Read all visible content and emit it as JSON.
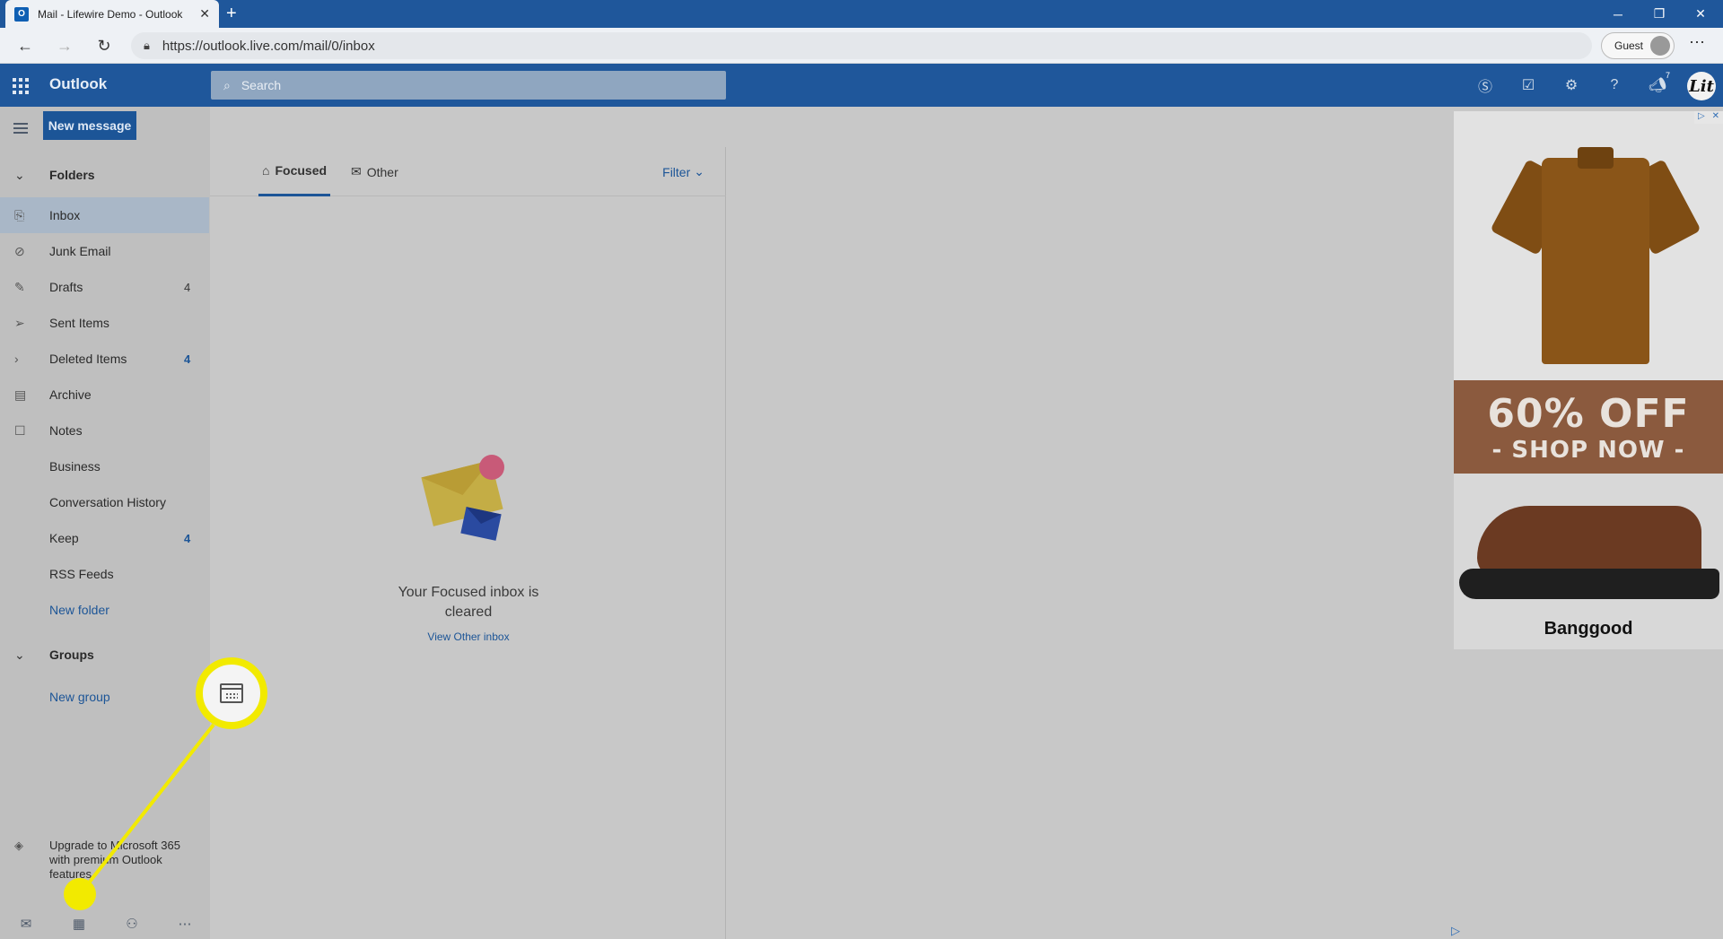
{
  "browser": {
    "tab_title": "Mail - Lifewire Demo - Outlook",
    "favicon": "O",
    "url": "https://outlook.live.com/mail/0/inbox",
    "profile_label": "Guest"
  },
  "app": {
    "name": "Outlook",
    "search_placeholder": "Search",
    "notification_count": "7",
    "avatar_initials": "Lit"
  },
  "toolbar": {
    "new_message": "New message"
  },
  "folders": {
    "header": "Folders",
    "items": [
      {
        "label": "Inbox",
        "count": "",
        "icon": "inbox-icon"
      },
      {
        "label": "Junk Email",
        "count": "",
        "icon": "blocked-icon"
      },
      {
        "label": "Drafts",
        "count": "4",
        "icon": "pencil-icon"
      },
      {
        "label": "Sent Items",
        "count": "",
        "icon": "send-icon"
      },
      {
        "label": "Deleted Items",
        "count": "4",
        "icon": "chevron-right-icon"
      },
      {
        "label": "Archive",
        "count": "",
        "icon": "archive-icon"
      },
      {
        "label": "Notes",
        "count": "",
        "icon": "note-icon"
      },
      {
        "label": "Business",
        "count": ""
      },
      {
        "label": "Conversation History",
        "count": ""
      },
      {
        "label": "Keep",
        "count": "4"
      },
      {
        "label": "RSS Feeds",
        "count": ""
      },
      {
        "label": "New folder",
        "count": ""
      }
    ]
  },
  "groups": {
    "header": "Groups",
    "new_group": "New group"
  },
  "upgrade": {
    "text": "Upgrade to Microsoft 365 with premium Outlook features"
  },
  "message_list": {
    "tab_focused": "Focused",
    "tab_other": "Other",
    "filter": "Filter",
    "empty_title": "Your Focused inbox is cleared",
    "empty_link": "View Other inbox"
  },
  "ad": {
    "offer_line1": "60% OFF",
    "offer_line2": "- SHOP NOW -",
    "brand": "Banggood"
  },
  "colors": {
    "header_blue": "#1f579b",
    "accent_blue": "#1c5597",
    "highlight_yellow": "#f2ea00"
  }
}
